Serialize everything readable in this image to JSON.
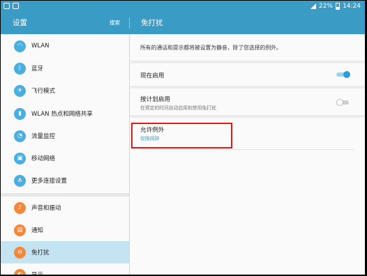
{
  "status_bar": {
    "battery": "22%",
    "time": "14:24"
  },
  "header": {
    "title": "设置",
    "search_label": "搜索",
    "detail_title": "免打扰"
  },
  "sidebar": {
    "items": [
      {
        "label": "WLAN",
        "icon": "wifi-icon",
        "glyph": "◠",
        "color": "#4aaee0"
      },
      {
        "label": "蓝牙",
        "icon": "bluetooth-icon",
        "glyph": "ᛒ",
        "color": "#4aaee0"
      },
      {
        "label": "飞行模式",
        "icon": "airplane-icon",
        "glyph": "✈",
        "color": "#4aaee0"
      },
      {
        "label": "WLAN 热点和网络共享",
        "icon": "hotspot-icon",
        "glyph": "▮",
        "color": "#4aaee0"
      },
      {
        "label": "流量监控",
        "icon": "data-usage-icon",
        "glyph": "◔",
        "color": "#4aaee0"
      },
      {
        "label": "移动网络",
        "icon": "mobile-network-icon",
        "glyph": "▣",
        "color": "#4aaee0"
      },
      {
        "label": "更多连接设置",
        "icon": "more-connections-icon",
        "glyph": "⋔",
        "color": "#4aaee0"
      },
      {
        "label": "声音和振动",
        "icon": "sound-icon",
        "glyph": "♪",
        "color": "#f3873b"
      },
      {
        "label": "通知",
        "icon": "notification-icon",
        "glyph": "▤",
        "color": "#f3873b"
      },
      {
        "label": "免打扰",
        "icon": "do-not-disturb-icon",
        "glyph": "⊖",
        "color": "#f3873b"
      },
      {
        "label": "显示",
        "icon": "display-icon",
        "glyph": "◐",
        "color": "#f3873b"
      }
    ],
    "selected_index": 9
  },
  "detail": {
    "description": "所有的通话和提示都将被设置为静音，除了您选择的例外。",
    "now_enable": {
      "label": "现在启用",
      "enabled": true
    },
    "schedule": {
      "label": "按计划启用",
      "sub": "在预定的时间自动启用和禁用免打扰",
      "enabled": false
    },
    "exceptions": {
      "label": "允许例外",
      "sub": "仅限闹钟"
    }
  },
  "colors": {
    "accent": "#3a9cc4",
    "highlight": "#e01b1b",
    "selected_row": "#c5e4f2"
  }
}
